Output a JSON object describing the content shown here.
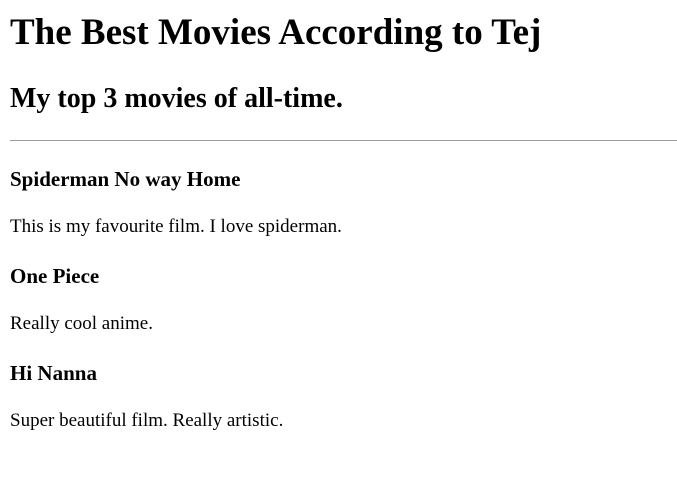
{
  "page": {
    "title": "The Best Movies According to Tej",
    "subtitle": "My top 3 movies of all-time."
  },
  "movies": [
    {
      "title": "Spiderman No way Home",
      "description": "This is my favourite film. I love spiderman."
    },
    {
      "title": "One Piece",
      "description": "Really cool anime."
    },
    {
      "title": "Hi Nanna",
      "description": "Super beautiful film. Really artistic."
    }
  ]
}
